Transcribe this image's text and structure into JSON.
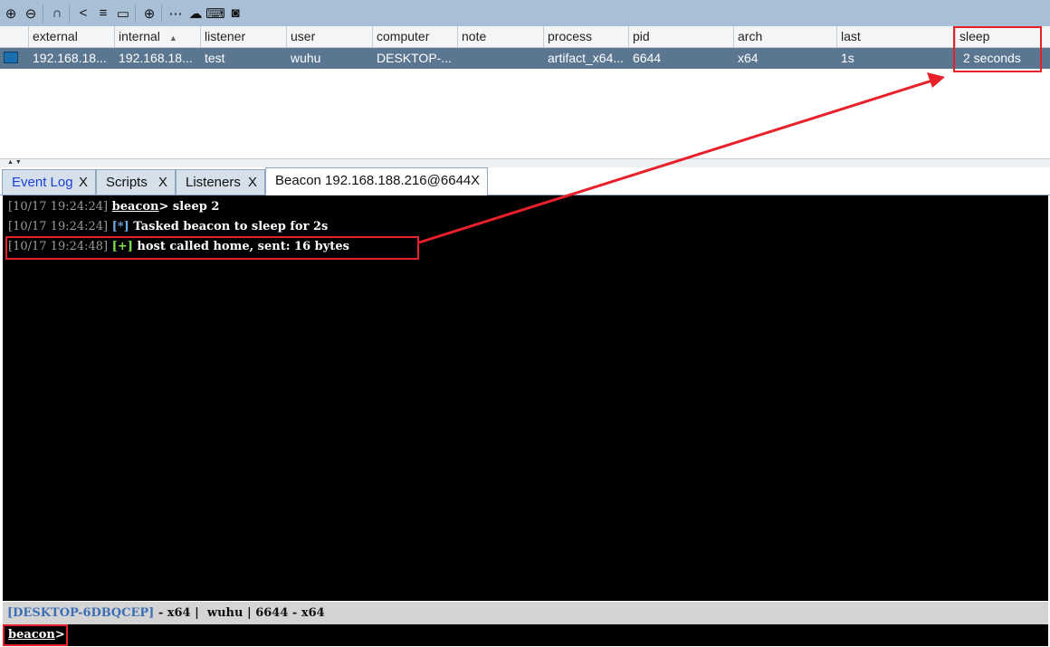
{
  "toolbar": {
    "icons": [
      "plus-circle-icon",
      "minus-circle-icon",
      "headphones-icon",
      "share-icon",
      "list-icon",
      "laptop-icon",
      "globe-icon",
      "dots-icon",
      "cloud-download-icon",
      "keyboard-icon",
      "camera-icon"
    ]
  },
  "table": {
    "columns": [
      "external",
      "internal",
      "listener",
      "user",
      "computer",
      "note",
      "process",
      "pid",
      "arch",
      "last",
      "sleep"
    ],
    "sort_indicator": "▲",
    "rows": [
      {
        "external": "192.168.18...",
        "internal": "192.168.18...",
        "listener": "test",
        "user": "wuhu",
        "computer": "DESKTOP-...",
        "note": "",
        "process": "artifact_x64...",
        "pid": "6644",
        "arch": "x64",
        "last": "1s",
        "sleep": "2 seconds"
      }
    ]
  },
  "tabs": [
    {
      "label": "Event Log",
      "close": "X"
    },
    {
      "label": "Scripts",
      "close": "X"
    },
    {
      "label": "Listeners",
      "close": "X"
    },
    {
      "label": "Beacon 192.168.188.216@6644",
      "close": "X"
    }
  ],
  "console": {
    "lines": [
      {
        "ts": "[10/17 19:24:24]",
        "prompt": "beacon",
        "cmd": "> sleep 2"
      },
      {
        "ts": "[10/17 19:24:24]",
        "tag": "[*]",
        "text": " Tasked beacon to sleep for 2s"
      },
      {
        "ts": "[10/17 19:24:48]",
        "tag": "[+]",
        "text": " host called home, sent: 16 bytes"
      }
    ]
  },
  "status": {
    "host": "[DESKTOP-6DBQCEP]",
    "rest": " - x64 |  wuhu | 6644 - x64"
  },
  "prompt": {
    "label": "beacon",
    "suffix": ">"
  },
  "colors": {
    "highlight": "#e8202a",
    "row_selected": "#5b7690",
    "info_tag": "#6fa8dc",
    "success_tag": "#7ee04a"
  }
}
